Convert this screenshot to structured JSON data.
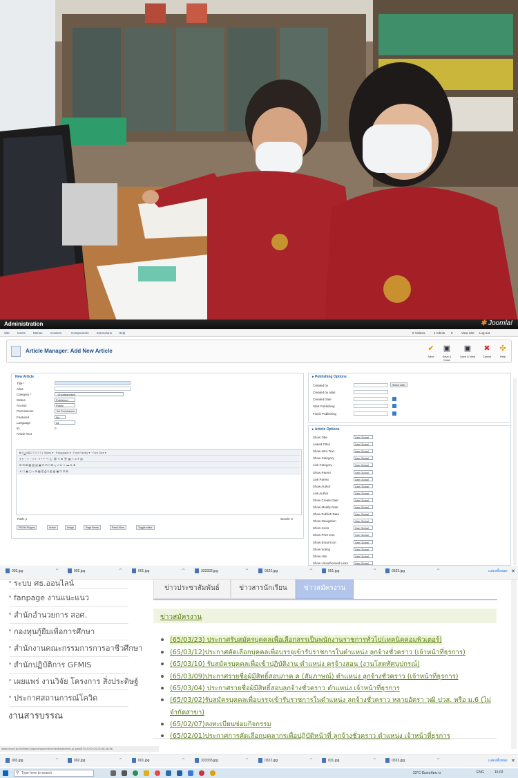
{
  "joomla": {
    "brand": "Administration",
    "logo": "Joomla!",
    "menu": [
      "Site",
      "Users",
      "Menus",
      "Content",
      "Components",
      "Extensions",
      "Help"
    ],
    "status": [
      "0 Visitors",
      "1 Admin",
      "0",
      "View Site",
      "Log out"
    ],
    "page_title": "Article Manager: Add New Article",
    "toolbar": [
      "Save",
      "Save & Close",
      "Save & New",
      "Cancel",
      "Help"
    ],
    "new_article": {
      "legend": "New Article",
      "fields": [
        {
          "label": "Title *",
          "value": ""
        },
        {
          "label": "Alias",
          "value": ""
        },
        {
          "label": "Category *",
          "value": "- Uncategorised"
        },
        {
          "label": "Status",
          "value": "Published"
        },
        {
          "label": "Access",
          "value": "Public"
        },
        {
          "label": "Permissions",
          "value": "Set Permissions"
        },
        {
          "label": "Featured",
          "value": "No"
        },
        {
          "label": "Language",
          "value": "All"
        },
        {
          "label": "ID",
          "value": "0"
        }
      ],
      "article_text_label": "Article Text",
      "editor_styles": "Styles",
      "editor_paragraph": "Paragraph",
      "editor_font_family": "Font Family",
      "editor_font_size": "Font Size",
      "path": "Path: p",
      "words": "Words: 0",
      "bottom_buttons": [
        "PDOH-Plugins",
        "Article",
        "Image",
        "Page Break",
        "Read More",
        "Toggle editor"
      ]
    },
    "publishing": {
      "legend": "Publishing Options",
      "fields": [
        "Created by",
        "Created by alias",
        "Created Date",
        "Start Publishing",
        "Finish Publishing"
      ],
      "select_user": "Select User"
    },
    "article_options": {
      "legend": "Article Options",
      "fields": [
        "Show Title",
        "Linked Titles",
        "Show Intro Text",
        "Show Category",
        "Link Category",
        "Show Parent",
        "Link Parent",
        "Show Author",
        "Link Author",
        "Show Create Date",
        "Show Modify Date",
        "Show Publish Date",
        "Show Navigation",
        "Show Icons",
        "Show Print Icon",
        "Show Email Icon",
        "Show Voting",
        "Show Hits",
        "Show Unauthorised Links"
      ],
      "value": "Use Global"
    }
  },
  "downloads_top": [
    "003.jpg",
    "002.jpg",
    "001.jpg",
    "333333.jpg",
    "0322.jpg",
    "551.jpg",
    "0333.jpg"
  ],
  "show_all": "แสดงทั้งหมด",
  "website": {
    "sidebar": [
      "ระบบ ศธ.ออนไลน์",
      "fanpage งานแนะแนว",
      "สำนักอำนวยการ สอศ.",
      "กองทุนกู้ยืมเพื่อการศึกษา",
      "สำนักงานคณะกรรมการการอาชีวศึกษา",
      "สำนักปฏิบัติการ GFMIS",
      "เผยแพร่ งานวิจัย โครงการ สิ่งประดิษฐ์",
      "ประกาศสถานการณ์โควิด"
    ],
    "section_heading": "งานสารบรรณ",
    "tabs": [
      "ข่าวประชาสัมพันธ์",
      "ข่าวสารนักเรียน",
      "ข่าวสมัครงาน"
    ],
    "news_title": "ข่าวสมัครงาน",
    "news": [
      "(65/03/23) ประกาศรับสมัครบุคคลเพื่อเลือกสรรเป็นพนักงานราชการทั่วไป(เทคนิคคอมพิวเตอร์)",
      "(65/03/12)ประกาศคัดเลือกบุคคลเพื่อบรรจุเข้ารับราชการในตำแหน่ง ลูกจ้างชั่วคราว (เจ้าหน้าที่ธุรการ)",
      "(65/03/10) รับสมัครบุคคลเพื่อเข้าปฏิบัติงาน ตำแหน่ง ครูจ้างสอน (งานโสตทัศนูปกรณ์)",
      "(65/03/09)ประกาศรายชื่อผู้มีสิทธิ์สอบภาค ค (สัมภาษณ์) ตำแหน่ง ลูกจ้างชั่วคราว (เจ้าหน้าที่ธุรการ)",
      "(65/03/04) ประกาศรายชื่อผู้มีสิทธิ์สอบลูกจ้างชั่วคราว ตำแหน่ง เจ้าหน้าที่ธุรการ",
      "(65/03/02)รับสมัครบุคคลเพื่อบรรจุเข้ารับราชการในตำแหน่ง ลูกจ้างชั่วคราว หลายอัตรา วุฒิ ปวส. หรือ ม.6 (ไม่",
      "จำกัดสาขา)",
      "(65/02/07)ลงทะเบียนซ่อมกิจกรรม",
      "(65/02/01)ประกาศการคัดเลือกบุคลากรเพื่อปฏิบัติหน้าที่ ลูกจ้างชั่วคราว ตำแหน่ง เจ้าหน้าที่ธุรการ"
    ],
    "status_url": "www.chcvc.ac.th/index.php/component/content/article/40-pr-jobs/870-2022-03-23-08-38-56"
  },
  "downloads_bottom": [
    "003.jpg",
    "002.jpg",
    "001.jpg",
    "333333.jpg",
    "0322.jpg",
    "031.jpg",
    "0333.jpg"
  ],
  "taskbar": {
    "search_placeholder": "Type here to search",
    "weather": "33°C มีแดดจัดบาง",
    "lang": "ENG",
    "time": "16:02"
  },
  "colors": {
    "news_green": "#5a7e17",
    "tab_active": "#b3c5eb",
    "joomla_orange": "#f48b22",
    "toolbar_blue": "#1f4d86"
  }
}
